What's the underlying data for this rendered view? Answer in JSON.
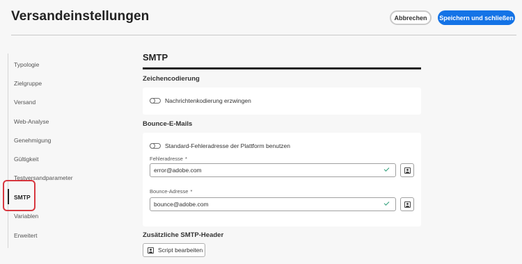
{
  "header": {
    "title": "Versandeinstellungen",
    "cancel_label": "Abbrechen",
    "save_label": "Speichern und schließen"
  },
  "sidebar": {
    "items": [
      {
        "label": "Typologie"
      },
      {
        "label": "Zielgruppe"
      },
      {
        "label": "Versand"
      },
      {
        "label": "Web-Analyse"
      },
      {
        "label": "Genehmigung"
      },
      {
        "label": "Gültigkeit"
      },
      {
        "label": "Testversandparameter"
      },
      {
        "label": "SMTP",
        "active": true
      },
      {
        "label": "Variablen"
      },
      {
        "label": "Erweitert"
      }
    ]
  },
  "main": {
    "title": "SMTP",
    "encoding": {
      "section_title": "Zeichencodierung",
      "toggle_label": "Nachrichtenkodierung erzwingen",
      "toggle_on": false
    },
    "bounce": {
      "section_title": "Bounce-E-Mails",
      "toggle_label": "Standard-Fehleradresse der Plattform benutzen",
      "toggle_on": false,
      "error_label": "Fehleradresse",
      "error_value": "error@adobe.com",
      "bounce_label": "Bounce-Adresse",
      "bounce_value": "bounce@adobe.com",
      "required_mark": "*"
    },
    "headers": {
      "section_title": "Zusätzliche SMTP-Header",
      "edit_script_label": "Script bearbeiten"
    }
  },
  "colors": {
    "accent": "#1473e6",
    "highlight": "#d7373f",
    "valid": "#2d9d78"
  }
}
